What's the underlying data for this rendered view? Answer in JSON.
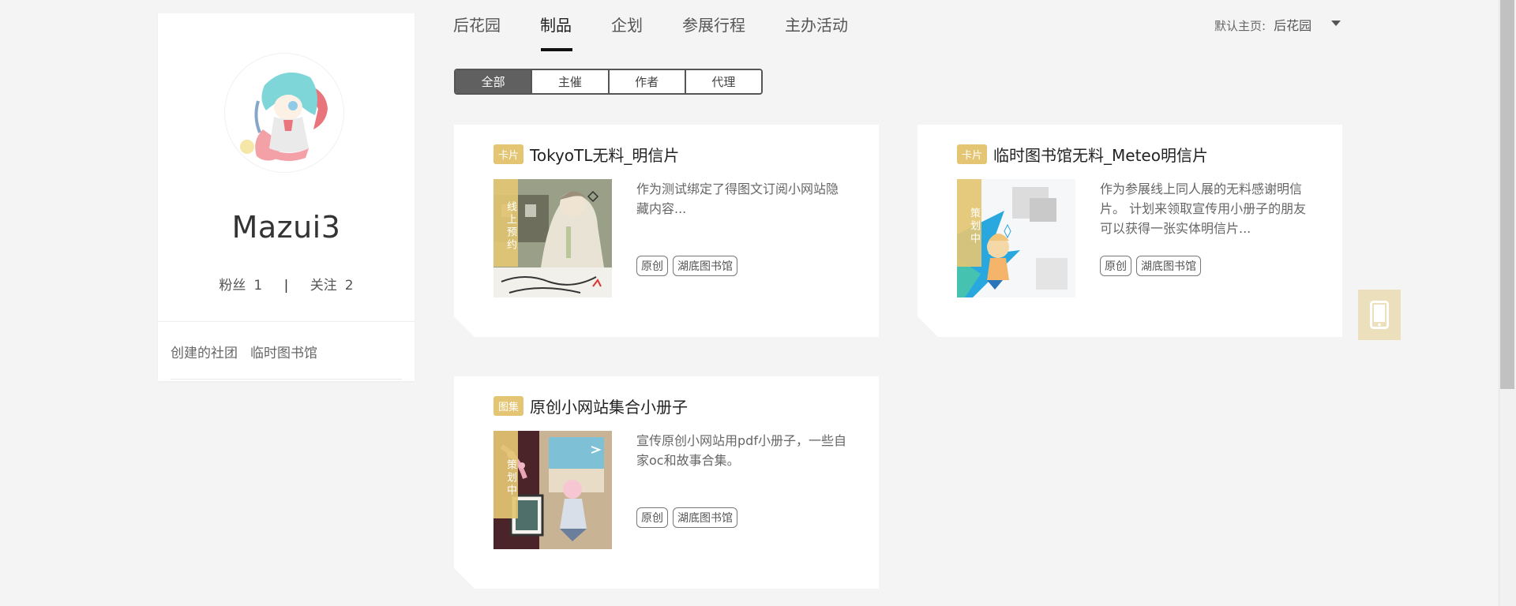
{
  "profile": {
    "username": "Mazui3",
    "fans_label": "粉丝",
    "fans_count": "1",
    "divider": "|",
    "follow_label": "关注",
    "follow_count": "2",
    "clubs_label": "创建的社团",
    "club_name": "临时图书馆"
  },
  "nav": {
    "tabs": [
      "后花园",
      "制品",
      "企划",
      "参展行程",
      "主办活动"
    ],
    "active_tab": "制品",
    "home_label": "默认主页:",
    "home_value": "后花园"
  },
  "filters": {
    "items": [
      "全部",
      "主催",
      "作者",
      "代理"
    ],
    "active": "全部"
  },
  "cards": [
    {
      "badge": "卡片",
      "title": "TokyoTL无料_明信片",
      "status": "线上预约",
      "description": "作为测试绑定了得图文订阅小网站隐藏内容...",
      "tags": [
        "原创",
        "湖底图书馆"
      ]
    },
    {
      "badge": "卡片",
      "title": "临时图书馆无料_Meteo明信片",
      "status": "策划中",
      "description": "作为参展线上同人展的无料感谢明信片。 计划来领取宣传用小册子的朋友可以获得一张实体明信片...",
      "tags": [
        "原创",
        "湖底图书馆"
      ]
    },
    {
      "badge": "图集",
      "title": "原创小网站集合小册子",
      "status": "策划中",
      "description": "宣传原创小网站用pdf小册子，一些自家oc和故事合集。",
      "tags": [
        "原创",
        "湖底图书馆"
      ]
    }
  ],
  "icons": {
    "floating": "tablet-icon",
    "home_caret": "caret-down-icon"
  },
  "colors": {
    "accent": "#e3c573",
    "floating_bg": "#ece0bc",
    "active_filter": "#606060"
  }
}
